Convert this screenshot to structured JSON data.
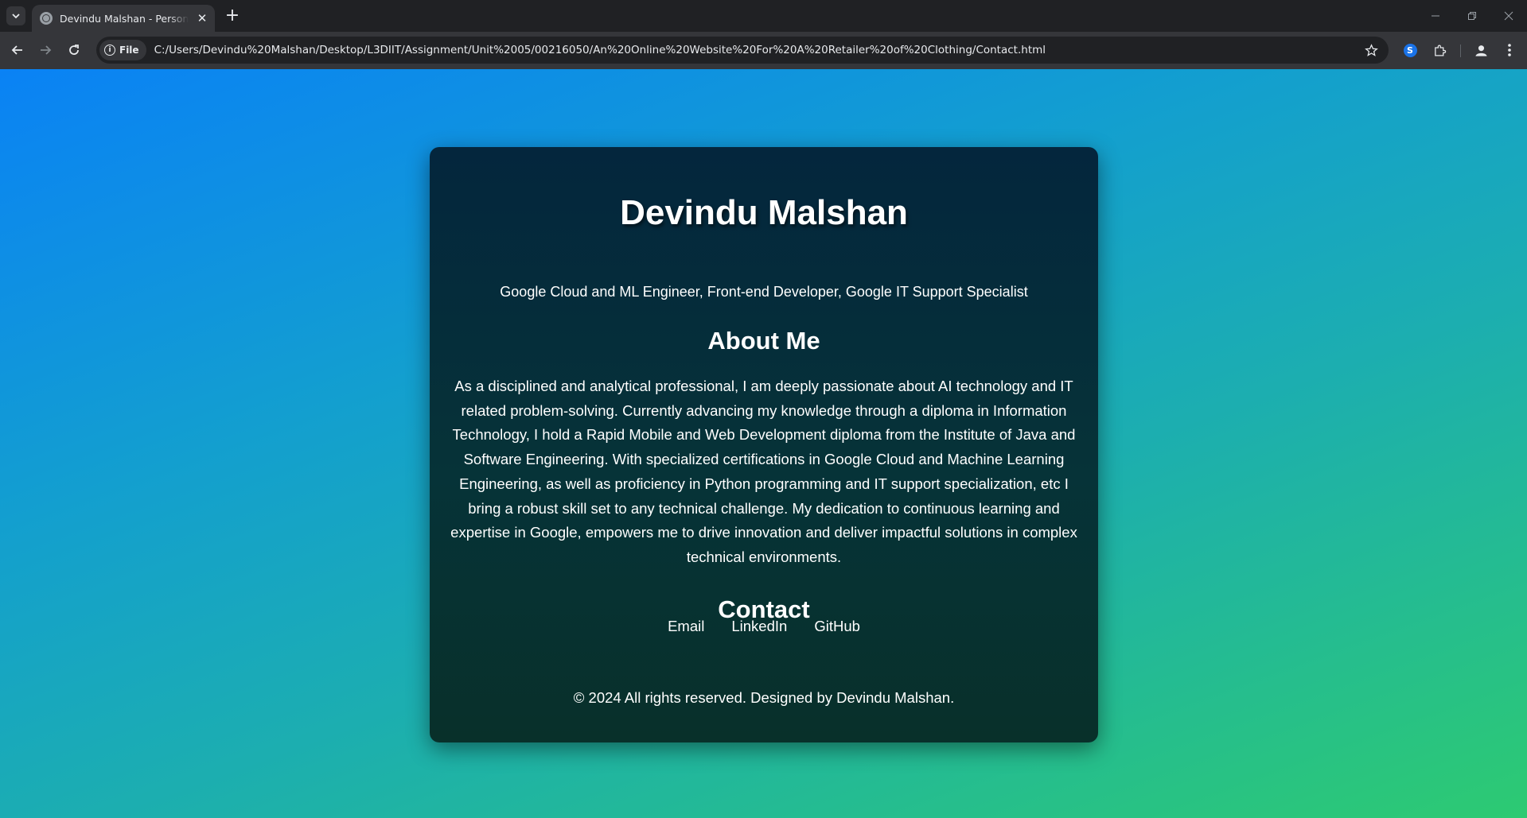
{
  "browser": {
    "tab_title": "Devindu Malshan - Personal Website",
    "security_chip": "File",
    "url": "C:/Users/Devindu%20Malshan/Desktop/L3DIIT/Assignment/Unit%2005/00216050/An%20Online%20Website%20For%20A%20Retailer%20of%20Clothing/Contact.html",
    "new_tab_glyph": "+",
    "close_glyph": "✕"
  },
  "page": {
    "name": "Devindu Malshan",
    "tagline": "Google Cloud and ML Engineer, Front-end Developer, Google IT Support Specialist",
    "about_title": "About Me",
    "about_text": "As a disciplined and analytical professional, I am deeply passionate about AI technology and IT related problem-solving. Currently advancing my knowledge through a diploma in Information Technology, I hold a Rapid Mobile and Web Development diploma from the Institute of Java and Software Engineering. With specialized certifications in Google Cloud and Machine Learning Engineering, as well as proficiency in Python programming and IT support specialization, etc I bring a robust skill set to any technical challenge. My dedication to continuous learning and expertise in Google, empowers me to drive innovation and deliver impactful solutions in complex technical environments.",
    "contact_title": "Contact",
    "contact_links": {
      "email": "Email",
      "linkedin": "LinkedIn",
      "github": "GitHub"
    },
    "footer": "© 2024 All rights reserved. Designed by Devindu Malshan."
  },
  "colors": {
    "background_gradient": [
      "#0a82f5",
      "#2dca72"
    ],
    "card": "#04263d",
    "text": "#ffffff"
  },
  "icons": [
    "tab-search-icon",
    "globe-favicon-icon",
    "close-icon",
    "plus-icon",
    "minimize-icon",
    "restore-icon",
    "window-close-icon",
    "back-arrow-icon",
    "forward-arrow-icon",
    "reload-icon",
    "info-icon",
    "star-icon",
    "extension-icon",
    "puzzle-icon",
    "profile-icon",
    "kebab-menu-icon"
  ]
}
